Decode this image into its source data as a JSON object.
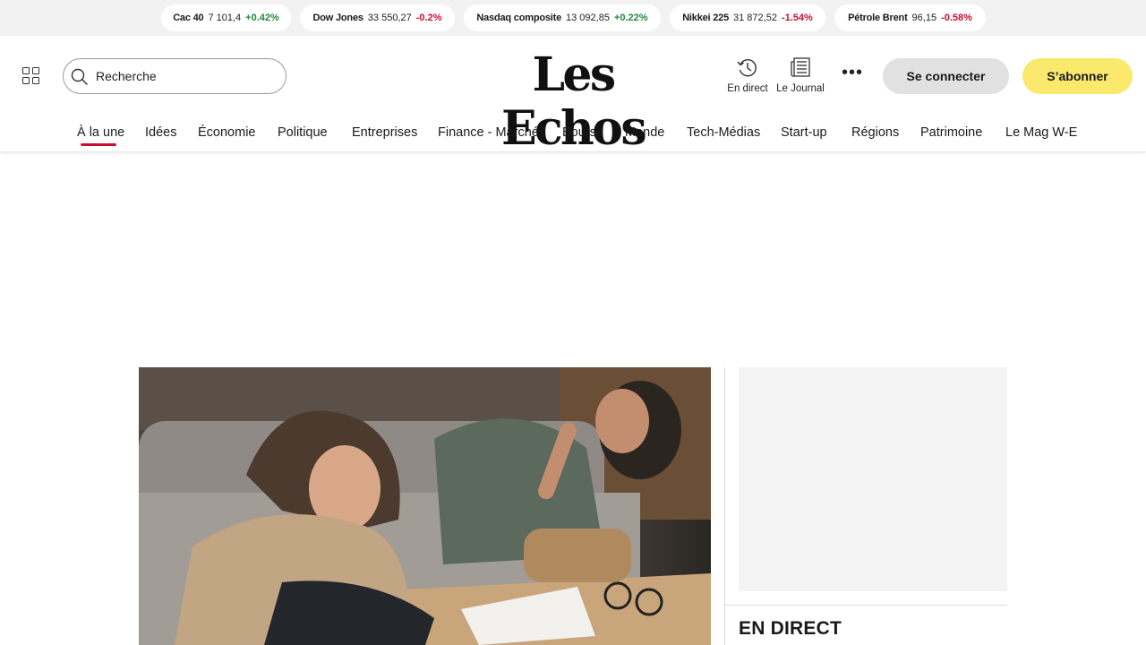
{
  "ticker": [
    {
      "name": "Cac 40",
      "value": "7 101,4",
      "change": "+0.42%",
      "direction": "up"
    },
    {
      "name": "Dow Jones",
      "value": "33 550,27",
      "change": "-0.2%",
      "direction": "down"
    },
    {
      "name": "Nasdaq composite",
      "value": "13 092,85",
      "change": "+0.22%",
      "direction": "up"
    },
    {
      "name": "Nikkei 225",
      "value": "31 872,52",
      "change": "-1.54%",
      "direction": "down"
    },
    {
      "name": "Pétrole Brent",
      "value": "96,15",
      "change": "-0.58%",
      "direction": "down"
    }
  ],
  "header": {
    "search_placeholder": "Recherche",
    "logo": "Les Echos",
    "live_label": "En direct",
    "journal_label": "Le Journal",
    "login_label": "Se connecter",
    "subscribe_label": "S’abonner"
  },
  "nav": {
    "items": [
      "À la une",
      "Idées",
      "Économie",
      "Politique",
      "Entreprises",
      "Finance - Marchés",
      "Bourse",
      "Monde",
      "Tech-Médias",
      "Start-up",
      "Régions",
      "Patrimoine",
      "Le Mag W-E"
    ],
    "active": "À la une"
  },
  "sidebar": {
    "live_title": "EN DIRECT"
  },
  "colors": {
    "accent": "#c8102e",
    "subscribe": "#fbe96d",
    "positive": "#1f8a3a",
    "negative": "#c8102e"
  }
}
